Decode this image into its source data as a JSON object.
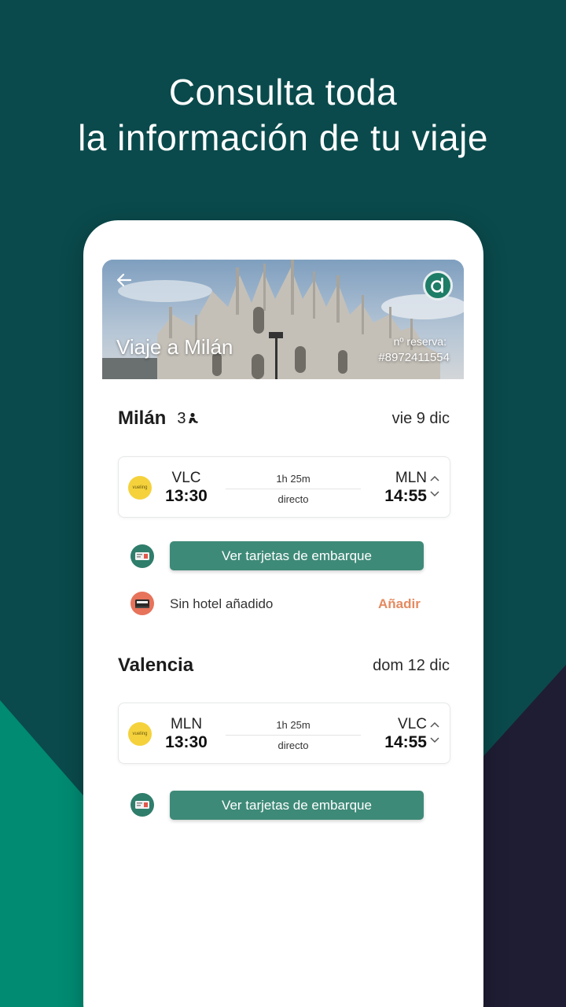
{
  "headline": {
    "line1": "Consulta toda",
    "line2": "la información de tu viaje"
  },
  "colors": {
    "background": "#0a4a4c",
    "accent_green": "#3e8a78",
    "accent_orange": "#e58a60",
    "teal_shape": "#008b72",
    "dark_shape": "#1f1d33"
  },
  "trip": {
    "title": "Viaje a Milán",
    "reserva_label": "nº reserva:",
    "reserva_number": "#8972411554",
    "back_icon": "arrow-left-icon",
    "brand_icon": "app-logo-icon"
  },
  "segments": [
    {
      "city": "Milán",
      "passengers": "3",
      "passenger_icon": "person-icon",
      "date": "vie 9 dic",
      "flight": {
        "airline": "vueling",
        "dep_code": "VLC",
        "dep_time": "13:30",
        "duration": "1h 25m",
        "stops": "directo",
        "arr_code": "MLN",
        "arr_time": "14:55"
      },
      "boarding_button": "Ver tarjetas de embarque",
      "hotel_text": "Sin hotel añadido",
      "hotel_action": "Añadir"
    },
    {
      "city": "Valencia",
      "date": "dom 12 dic",
      "flight": {
        "airline": "vueling",
        "dep_code": "MLN",
        "dep_time": "13:30",
        "duration": "1h 25m",
        "stops": "directo",
        "arr_code": "VLC",
        "arr_time": "14:55"
      },
      "boarding_button": "Ver tarjetas de embarque"
    }
  ]
}
